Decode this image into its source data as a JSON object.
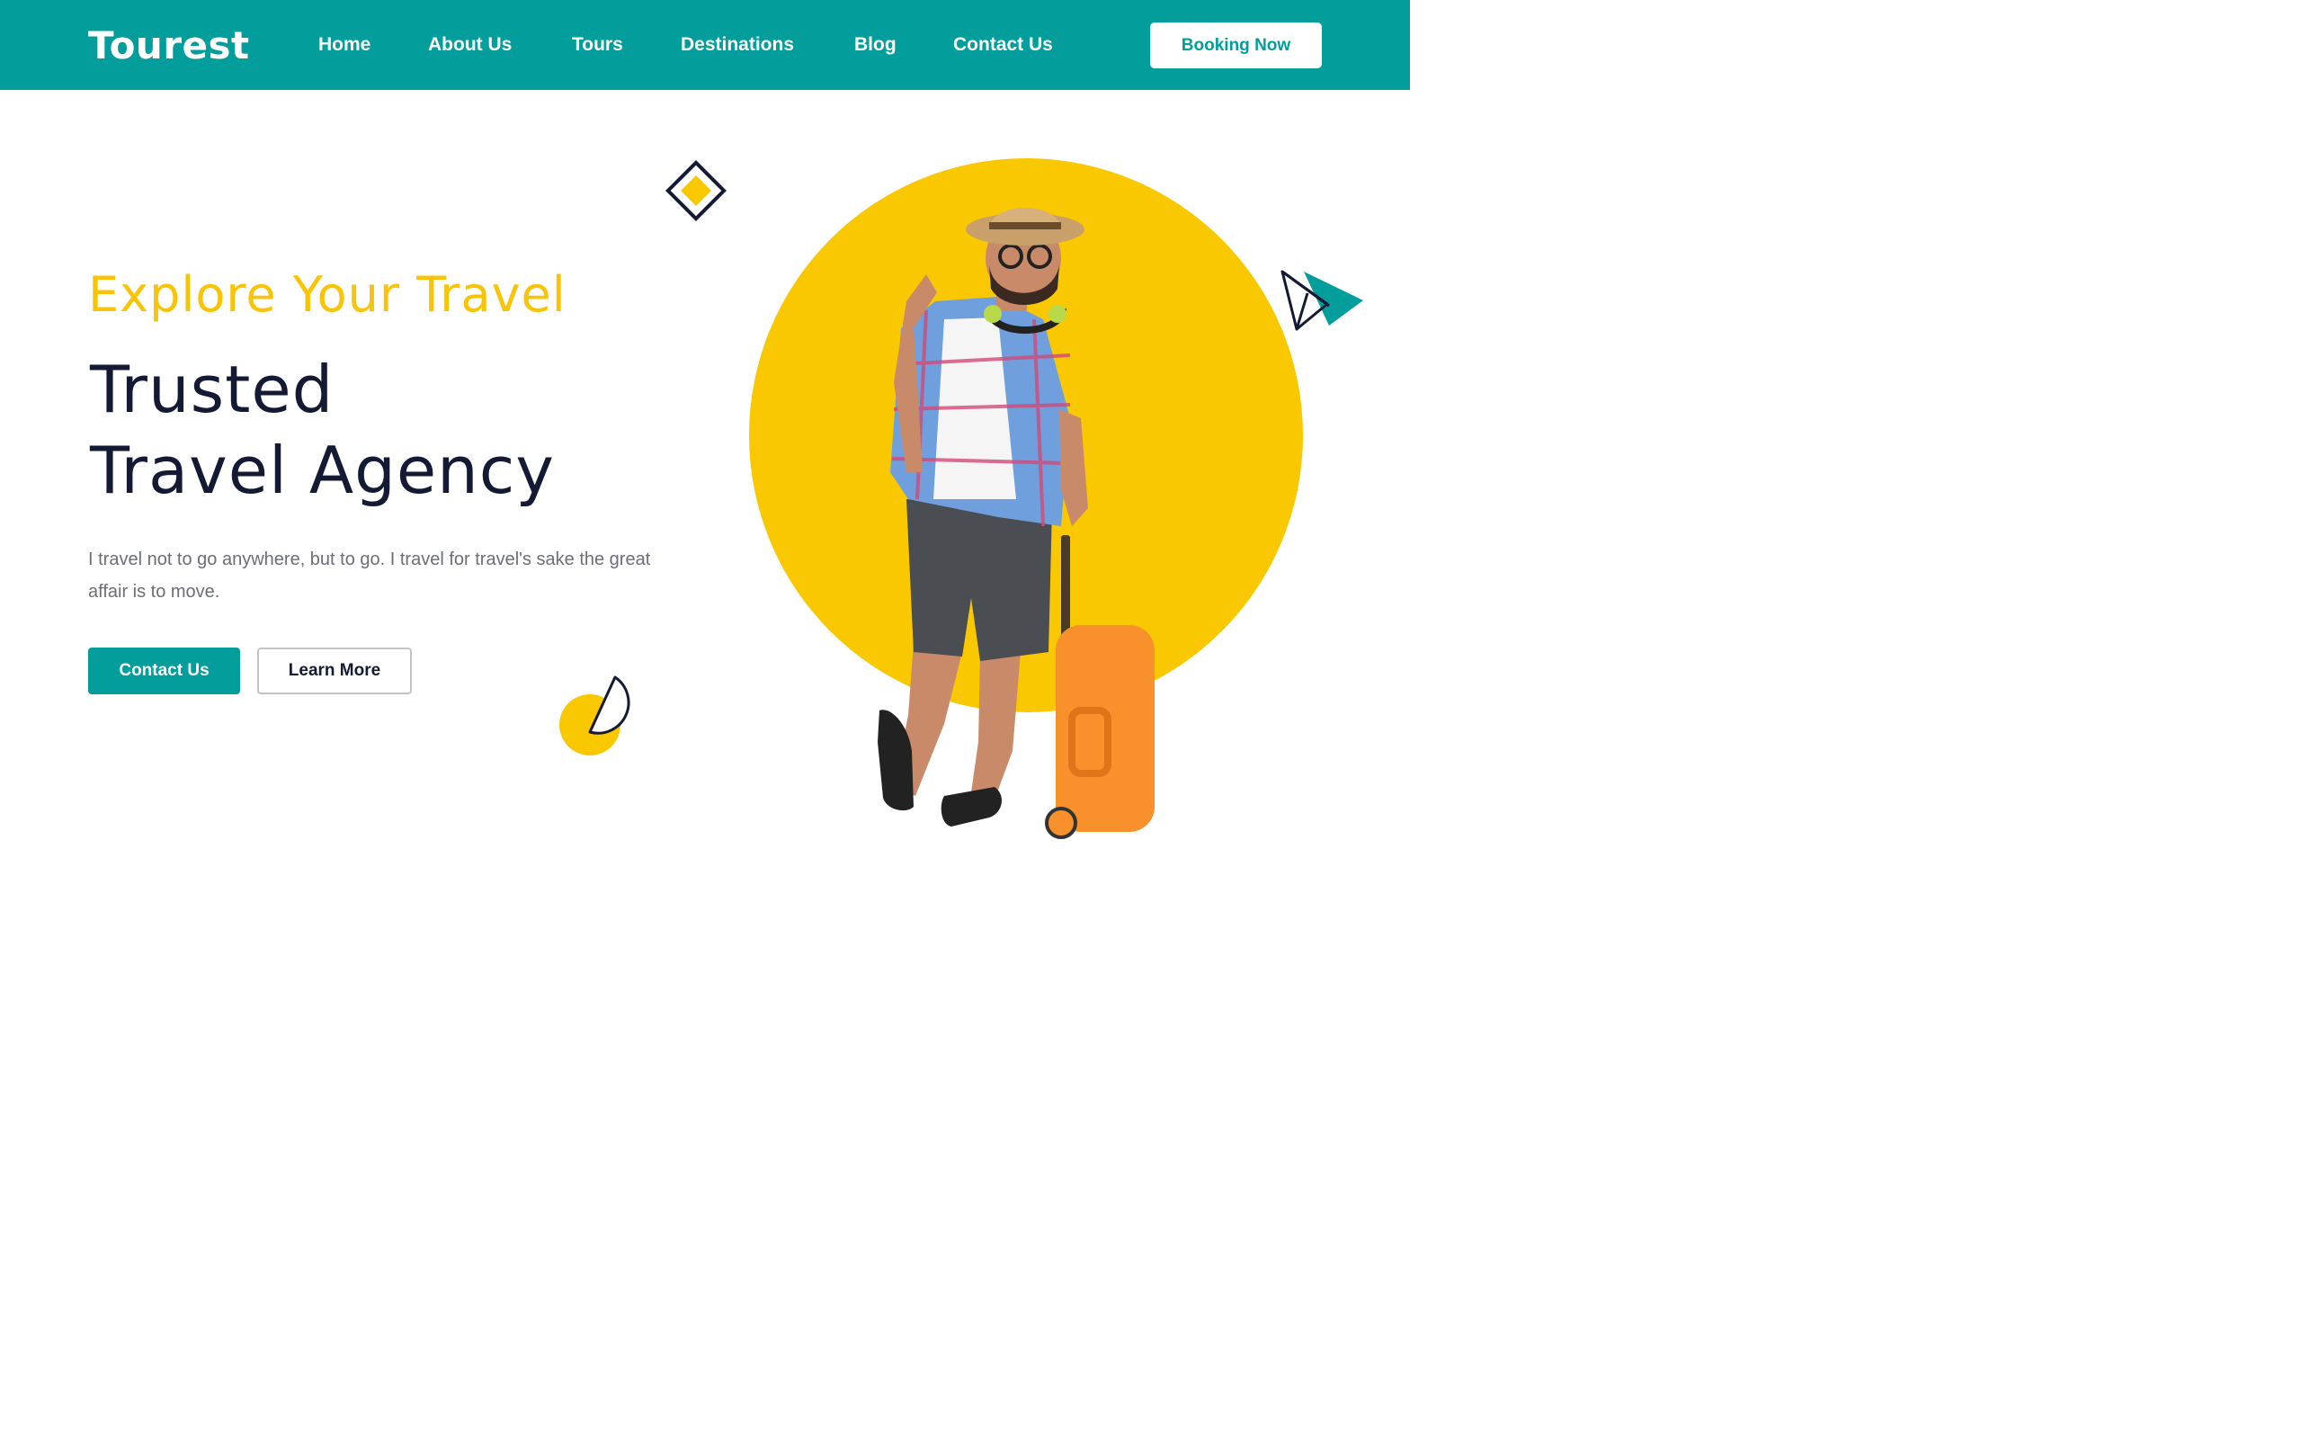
{
  "header": {
    "logo": "Tourest",
    "nav": [
      "Home",
      "About Us",
      "Tours",
      "Destinations",
      "Blog",
      "Contact Us"
    ],
    "cta": "Booking Now"
  },
  "hero": {
    "subtitle": "Explore Your Travel",
    "title_line1": "Trusted",
    "title_line2": "Travel Agency",
    "description": "I travel not to go anywhere, but to go. I travel for travel's sake the great affair is to move.",
    "primary_button": "Contact Us",
    "secondary_button": "Learn More"
  },
  "colors": {
    "brand": "#039e9b",
    "accent": "#fac800",
    "heading": "#141a33"
  },
  "icons": [
    "diamond-icon",
    "paper-plane-icon",
    "half-circle-icon"
  ]
}
